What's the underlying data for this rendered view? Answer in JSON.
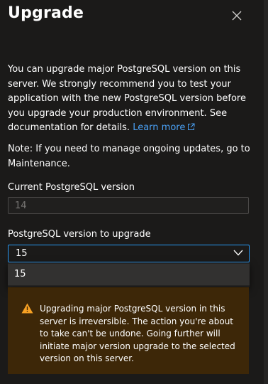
{
  "panel": {
    "title": "Upgrade"
  },
  "description": {
    "text": "You can upgrade major PostgreSQL version on this server. We strongly recommend you to test your application with the new PostgreSQL version before you upgrade your production environment. See documentation for details.",
    "link_label": "Learn more"
  },
  "note": {
    "text": "Note: If you need to manage ongoing updates, go to Maintenance."
  },
  "current_version": {
    "label": "Current PostgreSQL version",
    "value": "14"
  },
  "upgrade_version": {
    "label": "PostgreSQL version to upgrade",
    "selected": "15",
    "options": [
      "15"
    ]
  },
  "warning": {
    "text": "Upgrading major PostgreSQL version in this server is irreversible. The action you're about to take can't be undone. Going further will initiate major version upgrade to the selected version on this server."
  },
  "colors": {
    "background": "#1b1a19",
    "link": "#4aa0f4",
    "focus_border": "#2899f5",
    "warning_bg": "#3d2708",
    "warning_icon": "#f7a124"
  },
  "icons": {
    "close": "close-icon",
    "external_link": "external-link-icon",
    "chevron": "chevron-down-icon",
    "warning": "warning-icon"
  }
}
